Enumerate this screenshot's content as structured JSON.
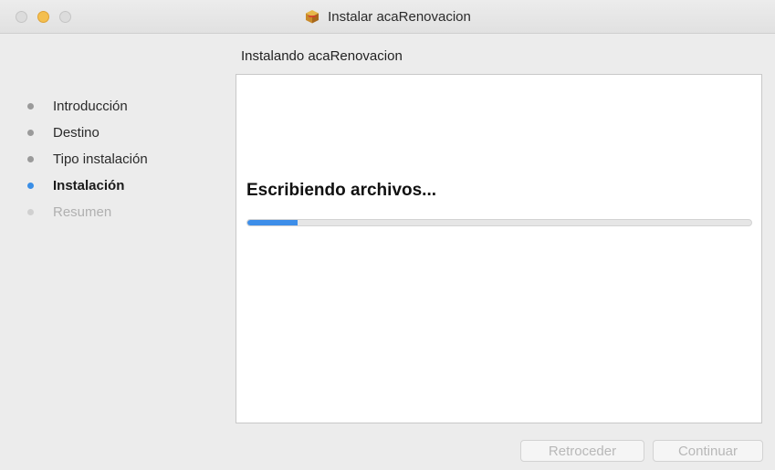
{
  "window": {
    "title": "Instalar acaRenovacion",
    "title_icon": "package-icon"
  },
  "sidebar": {
    "steps": [
      {
        "label": "Introducción",
        "state": "done"
      },
      {
        "label": "Destino",
        "state": "done"
      },
      {
        "label": "Tipo instalación",
        "state": "done"
      },
      {
        "label": "Instalación",
        "state": "active"
      },
      {
        "label": "Resumen",
        "state": "pending"
      }
    ]
  },
  "main": {
    "heading": "Instalando acaRenovacion",
    "status": "Escribiendo archivos...",
    "progress_percent": 10
  },
  "buttons": {
    "back_label": "Retroceder",
    "continue_label": "Continuar",
    "back_enabled": false,
    "continue_enabled": false
  },
  "colors": {
    "accent": "#3d8ee9",
    "minimize": "#f4bf4f"
  }
}
